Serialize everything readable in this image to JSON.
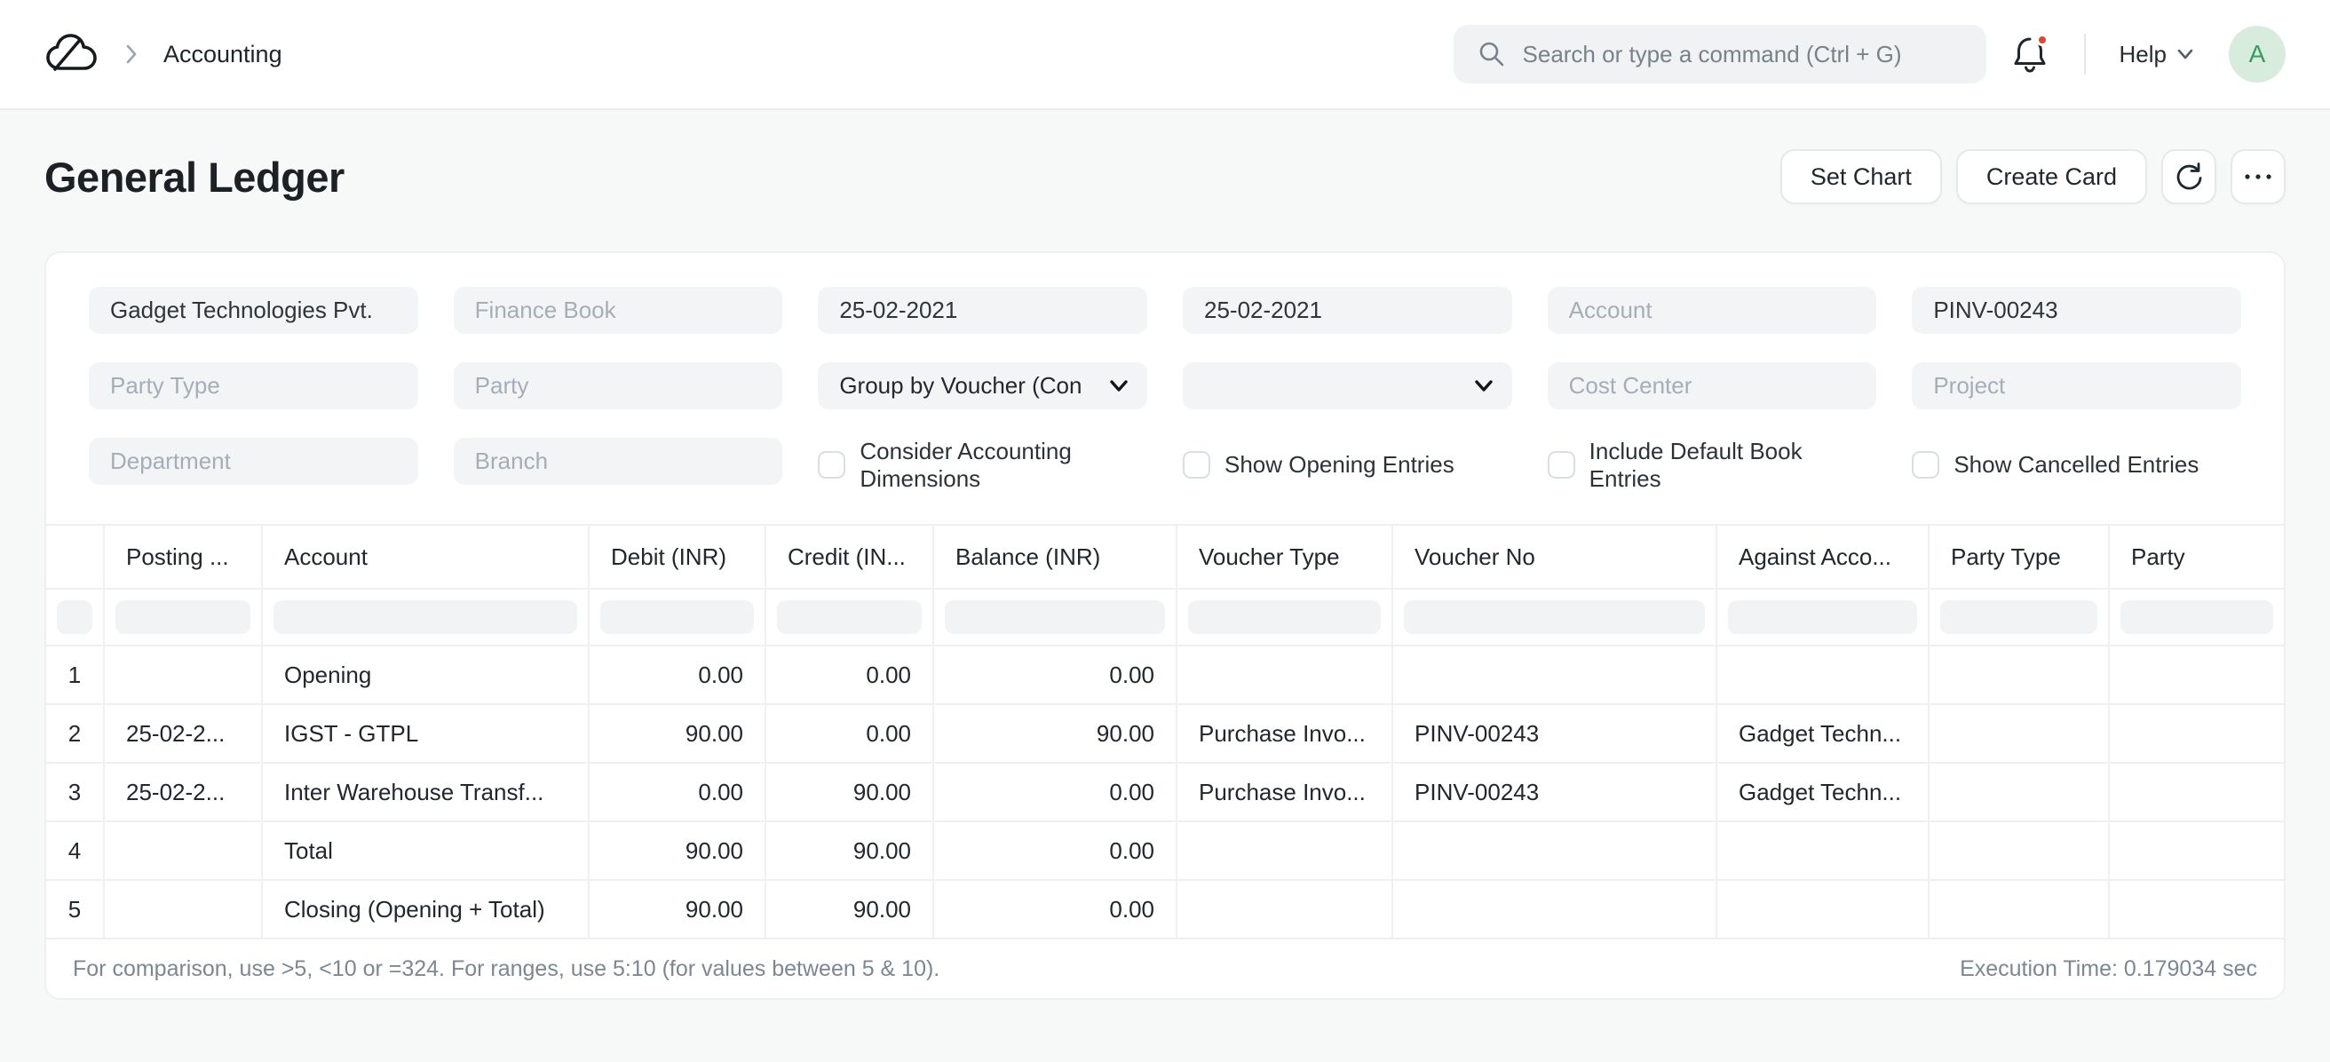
{
  "nav": {
    "breadcrumb": "Accounting",
    "search_placeholder": "Search or type a command (Ctrl + G)",
    "help_label": "Help",
    "avatar_letter": "A"
  },
  "header": {
    "title": "General Ledger",
    "set_chart_label": "Set Chart",
    "create_card_label": "Create Card"
  },
  "filters": {
    "company": {
      "value": "Gadget Technologies Pvt."
    },
    "finance_book": {
      "placeholder": "Finance Book"
    },
    "from_date": {
      "value": "25-02-2021"
    },
    "to_date": {
      "value": "25-02-2021"
    },
    "account": {
      "placeholder": "Account"
    },
    "voucher_no": {
      "value": "PINV-00243"
    },
    "party_type": {
      "placeholder": "Party Type"
    },
    "party": {
      "placeholder": "Party"
    },
    "group_by": {
      "value": "Group by Voucher (Con"
    },
    "secondary_select": {
      "value": ""
    },
    "cost_center": {
      "placeholder": "Cost Center"
    },
    "project": {
      "placeholder": "Project"
    },
    "department": {
      "placeholder": "Department"
    },
    "branch": {
      "placeholder": "Branch"
    },
    "checkboxes": [
      {
        "label": "Consider Accounting Dimensions",
        "checked": false
      },
      {
        "label": "Show Opening Entries",
        "checked": false
      },
      {
        "label": "Include Default Book Entries",
        "checked": false
      },
      {
        "label": "Show Cancelled Entries",
        "checked": false
      }
    ]
  },
  "table": {
    "columns": [
      "",
      "Posting ...",
      "Account",
      "Debit (INR)",
      "Credit (IN...",
      "Balance (INR)",
      "Voucher Type",
      "Voucher No",
      "Against Acco...",
      "Party Type",
      "Party"
    ],
    "rows": [
      {
        "idx": "1",
        "posting_date": "",
        "account": "Opening",
        "debit": "0.00",
        "credit": "0.00",
        "balance": "0.00",
        "voucher_type": "",
        "voucher_no": "",
        "against": "",
        "party_type": "",
        "party": ""
      },
      {
        "idx": "2",
        "posting_date": "25-02-2...",
        "account": "IGST - GTPL",
        "debit": "90.00",
        "credit": "0.00",
        "balance": "90.00",
        "voucher_type": "Purchase Invo...",
        "voucher_no": "PINV-00243",
        "against": "Gadget Techn...",
        "party_type": "",
        "party": ""
      },
      {
        "idx": "3",
        "posting_date": "25-02-2...",
        "account": "Inter Warehouse Transf...",
        "debit": "0.00",
        "credit": "90.00",
        "balance": "0.00",
        "voucher_type": "Purchase Invo...",
        "voucher_no": "PINV-00243",
        "against": "Gadget Techn...",
        "party_type": "",
        "party": ""
      },
      {
        "idx": "4",
        "posting_date": "",
        "account": "Total",
        "debit": "90.00",
        "credit": "90.00",
        "balance": "0.00",
        "voucher_type": "",
        "voucher_no": "",
        "against": "",
        "party_type": "",
        "party": ""
      },
      {
        "idx": "5",
        "posting_date": "",
        "account": "Closing (Opening + Total)",
        "debit": "90.00",
        "credit": "90.00",
        "balance": "0.00",
        "voucher_type": "",
        "voucher_no": "",
        "against": "",
        "party_type": "",
        "party": ""
      }
    ]
  },
  "footer": {
    "hint": "For comparison, use >5, <10 or =324. For ranges, use 5:10 (for values between 5 & 10).",
    "execution_time": "Execution Time: 0.179034 sec"
  },
  "icons": {
    "logo": "cloud-logo",
    "breadcrumb_separator": "chevron-right",
    "search": "magnifier",
    "notifications": "bell-with-red-dot",
    "help_caret": "chevron-down",
    "refresh": "circular-arrow",
    "more": "horizontal-ellipsis",
    "select_caret": "chevron-down"
  },
  "colors": {
    "page_background": "#f7f8f8",
    "card_background": "#ffffff",
    "input_background": "#f3f4f6",
    "text_dark": "#1f272e",
    "text_muted": "#7b8793",
    "placeholder": "#a4aeb8",
    "avatar_background": "#d7ecdc",
    "avatar_letter": "#359e5e",
    "notification_dot": "#e0452d",
    "border_light": "#eef0f2"
  }
}
